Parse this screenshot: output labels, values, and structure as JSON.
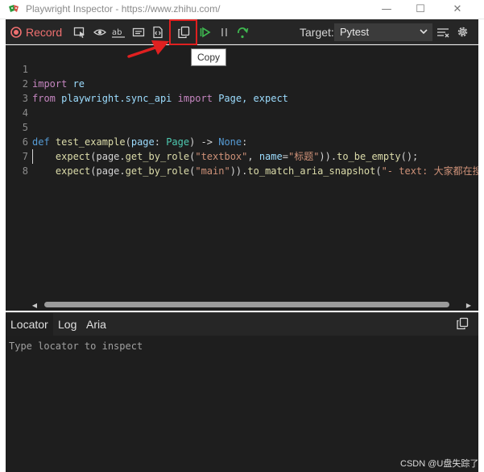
{
  "window": {
    "title": "Playwright Inspector - https://www.zhihu.com/",
    "minimize_glyph": "—",
    "maximize_glyph": "☐",
    "close_glyph": "✕"
  },
  "toolbar": {
    "record_label": "Record",
    "target_label": "Target:",
    "target_value": "Pytest",
    "icons": [
      "record-icon",
      "pick-locator-icon",
      "assert-visibility-icon",
      "assert-text-icon",
      "assert-value-icon",
      "assert-snapshot-icon",
      "copy-icon",
      "resume-icon",
      "pause-icon",
      "step-over-icon",
      "clear-icon",
      "settings-icon"
    ]
  },
  "tooltip": {
    "text": "Copy"
  },
  "editor": {
    "lines": [
      {
        "n": "1",
        "text": "import re"
      },
      {
        "n": "2",
        "text": "from playwright.sync_api import Page, expect"
      },
      {
        "n": "3",
        "text": ""
      },
      {
        "n": "4",
        "text": ""
      },
      {
        "n": "5",
        "text": "def test_example(page: Page) -> None:"
      },
      {
        "n": "6",
        "text": "    expect(page.get_by_role(\"textbox\", name=\"标题\")).to_be_empty();"
      },
      {
        "n": "7",
        "text": "    expect(page.get_by_role(\"main\")).to_match_aria_snapshot(\"- text: 大家都在搜"
      },
      {
        "n": "8",
        "text": ""
      }
    ],
    "tokens": {
      "l1_import": "import",
      "l1_re": " re",
      "l2_from": "from",
      "l2_module": " playwright.sync_api ",
      "l2_import": "import",
      "l2_names": " Page, expect",
      "l5_def": "def",
      "l5_name": " test_example",
      "l5_paren": "(",
      "l5_param": "page",
      "l5_colon": ": ",
      "l5_type": "Page",
      "l5_arrow": ") -> ",
      "l5_none": "None",
      "l5_end": ":",
      "l6_indent": "    ",
      "l6_expect": "expect",
      "l6_a": "(page.",
      "l6_method": "get_by_role",
      "l6_b": "(",
      "l6_str1": "\"textbox\"",
      "l6_c": ", ",
      "l6_name": "name",
      "l6_eq": "=",
      "l6_str2": "\"标题\"",
      "l6_d": ")).",
      "l6_assert": "to_be_empty",
      "l6_e": "();",
      "l7_indent": "    ",
      "l7_expect": "expect",
      "l7_a": "(page.",
      "l7_method": "get_by_role",
      "l7_b": "(",
      "l7_str1": "\"main\"",
      "l7_c": ")).",
      "l7_assert": "to_match_aria_snapshot",
      "l7_d": "(",
      "l7_str2": "\"- text: 大家都在搜"
    }
  },
  "panel": {
    "tabs": [
      "Locator",
      "Log",
      "Aria"
    ],
    "active_tab": "Locator",
    "locator_placeholder": "Type locator to inspect"
  },
  "watermark": "CSDN @U盘失踪了",
  "colors": {
    "accent_record": "#f07070",
    "annotation_red": "#e02020",
    "editor_bg": "#1e1e1e",
    "toolbar_bg": "#262626"
  }
}
